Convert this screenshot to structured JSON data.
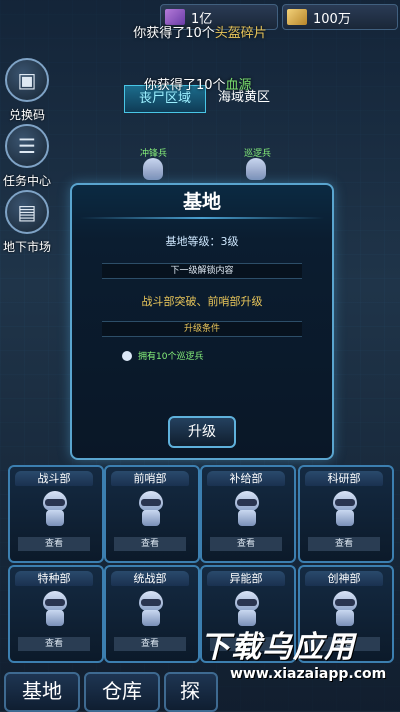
{
  "resources": {
    "gem": "1亿",
    "gold": "100万"
  },
  "toasts": {
    "top_prefix": "你获得了10个",
    "top_item": "头盔碎片",
    "mid_prefix": "你获得了10个",
    "mid_item": "血源"
  },
  "side_menu": [
    {
      "label": "兑换码",
      "icon": "chest-icon"
    },
    {
      "label": "任务中心",
      "icon": "list-icon"
    },
    {
      "label": "地下市场",
      "icon": "cart-icon"
    }
  ],
  "zones": {
    "active": "丧尸区域",
    "other": "海域黄区"
  },
  "units": [
    "冲锋兵",
    "巡逻兵"
  ],
  "dialog": {
    "title": "基地",
    "level_text": "基地等级：3级",
    "unlock_header": "下一级解锁内容",
    "unlock_content": "战斗部突破、前哨部升级",
    "condition_header": "升级条件",
    "condition_item": "拥有10个巡逻兵",
    "upgrade_label": "升级"
  },
  "departments": [
    {
      "name": "战斗部",
      "action": "查看"
    },
    {
      "name": "前哨部",
      "action": "查看"
    },
    {
      "name": "补给部",
      "action": "查看"
    },
    {
      "name": "科研部",
      "action": "查看"
    },
    {
      "name": "特种部",
      "action": "查看"
    },
    {
      "name": "统战部",
      "action": "查看"
    },
    {
      "name": "异能部",
      "action": "查看"
    },
    {
      "name": "创神部",
      "action": "查看"
    }
  ],
  "bottom_nav": [
    "基地",
    "仓库",
    "探"
  ],
  "watermark": {
    "text": "下载乌应用",
    "url": "www.xiazaiapp.com"
  },
  "colors": {
    "accent": "#5aa5cf",
    "highlight_gold": "#e8c55a",
    "highlight_green": "#7be06e"
  }
}
